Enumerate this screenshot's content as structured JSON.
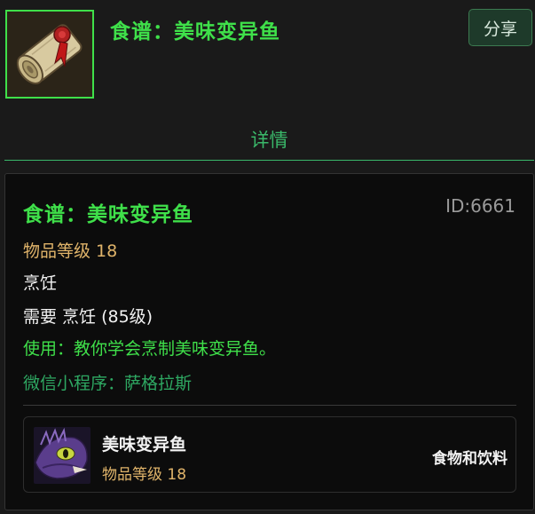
{
  "header": {
    "item_icon": "recipe-scroll-icon",
    "title": "食谱：美味变异鱼",
    "share_label": "分享"
  },
  "tabs": [
    {
      "label": "详情",
      "active": true
    }
  ],
  "details": {
    "title": "食谱：美味变异鱼",
    "id_text": "ID:6661",
    "item_level": "物品等级 18",
    "skill": "烹饪",
    "requirement": "需要 烹饪 (85级)",
    "use_text": "使用：教你学会烹制美味变异鱼。",
    "mini_program": "微信小程序：萨格拉斯"
  },
  "result": {
    "icon": "mutated-fish-icon",
    "name": "美味变异鱼",
    "item_level": "物品等级 18",
    "category": "食物和饮料"
  },
  "colors": {
    "page_bg": "#1a1a1a",
    "card_bg": "#0c0c0c",
    "uncommon_green": "#3fe04a",
    "accent_green": "#3ab86a",
    "item_level_gold": "#e0b46a"
  }
}
